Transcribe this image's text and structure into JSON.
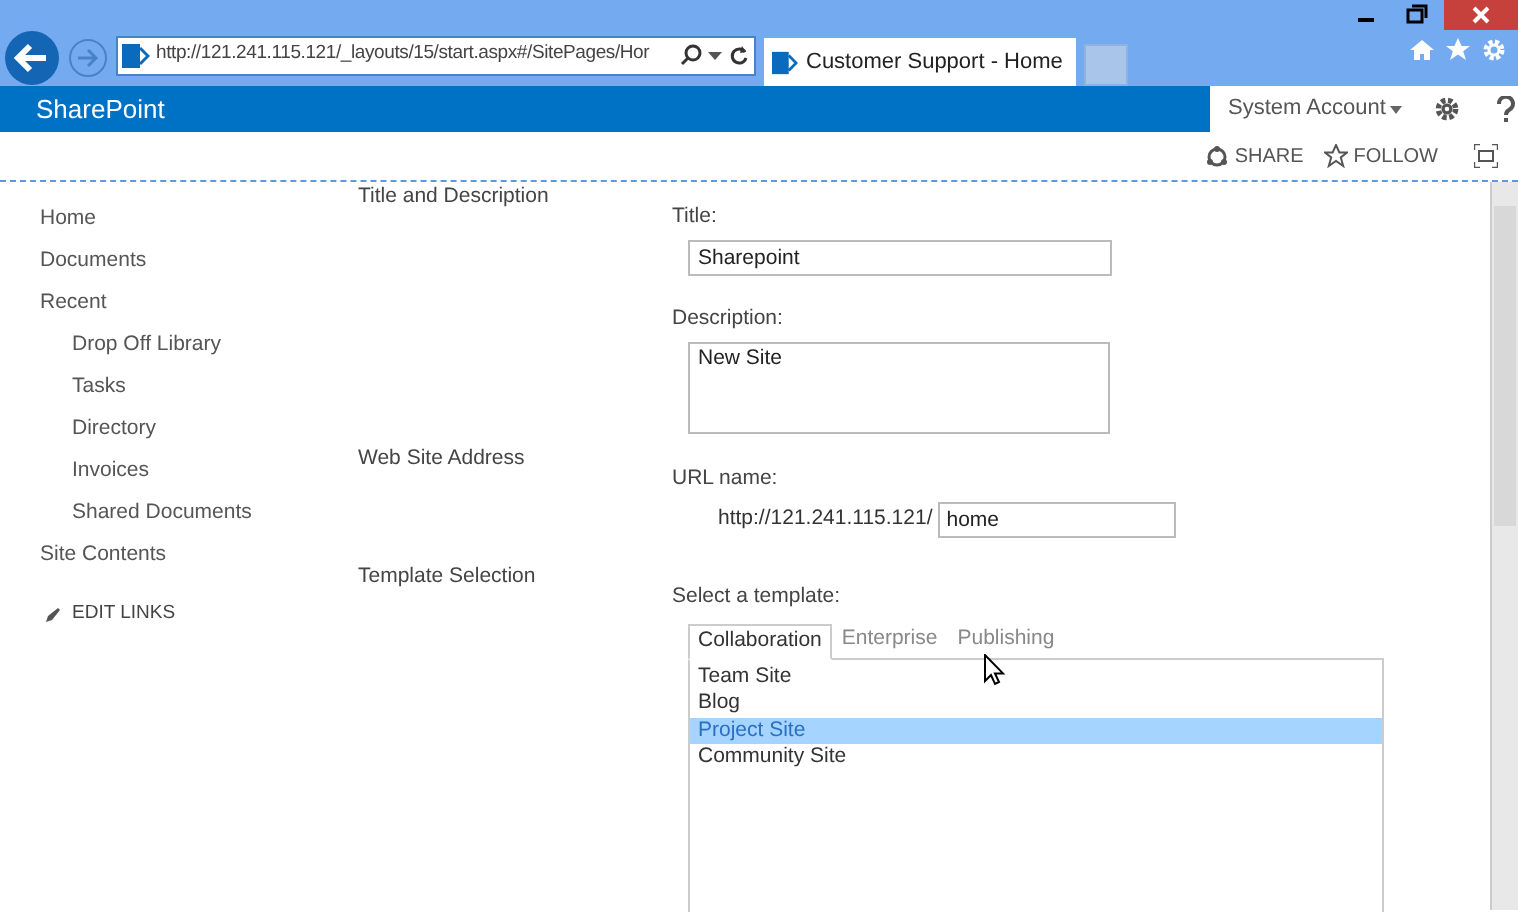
{
  "browser": {
    "address": "http://121.241.115.121/_layouts/15/start.aspx#/SitePages/Hor",
    "tab_title": "Customer Support - Home"
  },
  "suite_bar": {
    "brand": "SharePoint",
    "user": "System Account"
  },
  "page_actions": [
    "SHARE",
    "FOLLOW"
  ],
  "quick_launch": [
    {
      "label": "Home"
    },
    {
      "label": "Documents"
    },
    {
      "label": "Recent",
      "children": [
        {
          "label": "Drop Off Library"
        },
        {
          "label": "Tasks"
        },
        {
          "label": "Directory"
        },
        {
          "label": "Invoices"
        },
        {
          "label": "Shared Documents"
        }
      ]
    },
    {
      "label": "Site Contents"
    }
  ],
  "edit_links": "EDIT LINKS",
  "sections": [
    "Title and Description",
    "Web Site Address",
    "Template Selection"
  ],
  "form": {
    "title_label": "Title:",
    "title_value": "Sharepoint",
    "description_label": "Description:",
    "description_value": "New Site",
    "url_label": "URL name:",
    "url_prefix": "http://121.241.115.121/",
    "url_value": "home",
    "template_label": "Select a template:",
    "template_tabs": [
      {
        "label": "Collaboration",
        "selected": true
      },
      {
        "label": "Enterprise",
        "selected": false
      },
      {
        "label": "Publishing",
        "selected": false
      }
    ],
    "templates": [
      {
        "label": "Team Site",
        "selected": false
      },
      {
        "label": "Blog",
        "selected": false
      },
      {
        "label": "Project Site",
        "selected": true
      },
      {
        "label": "Community Site",
        "selected": false
      }
    ]
  }
}
